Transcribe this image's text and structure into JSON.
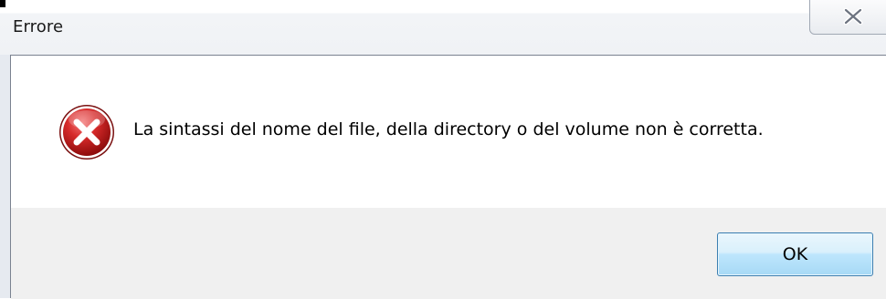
{
  "window": {
    "title": "Errore"
  },
  "dialog": {
    "message": "La sintassi del nome del file, della directory o del volume non è corretta.",
    "icon": "error-icon",
    "ok_label": "OK"
  },
  "colors": {
    "error_red": "#c8102e",
    "button_border": "#3c7fb1",
    "footer_bg": "#f0f0f0"
  }
}
